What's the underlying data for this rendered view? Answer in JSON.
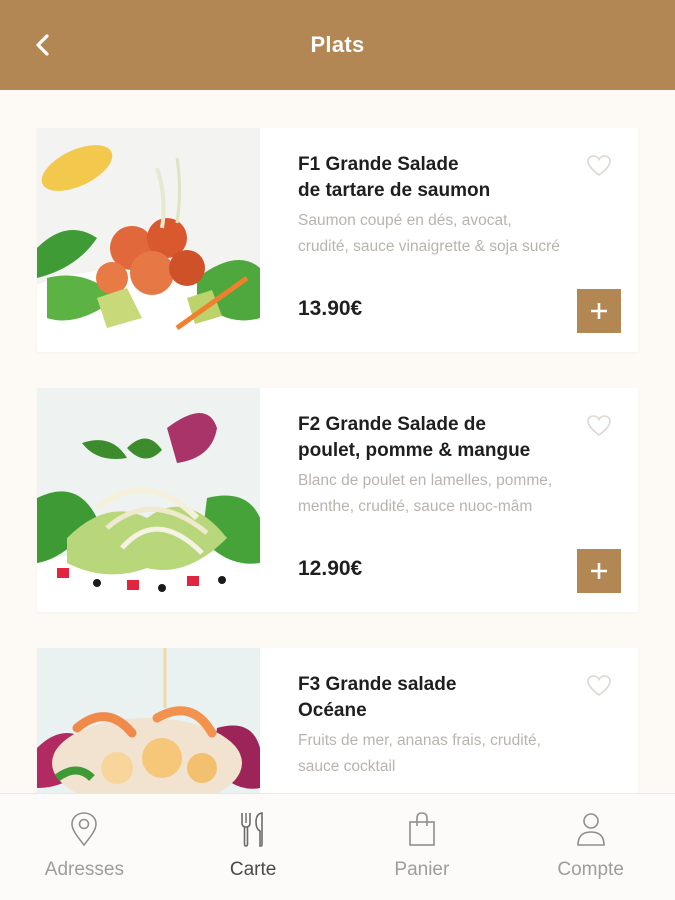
{
  "header": {
    "title": "Plats",
    "back_icon": "chevron-left-icon"
  },
  "dishes": [
    {
      "title": "F1 Grande Salade\nde tartare de saumon",
      "description": "Saumon coupé en dés, avocat,\ncrudité, sauce vinaigrette & soja sucré",
      "price": "13.90€",
      "favorite_icon": "heart-outline-icon",
      "add_icon": "plus-icon"
    },
    {
      "title": "F2 Grande Salade de\npoulet, pomme & mangue",
      "description": "Blanc de poulet en lamelles, pomme,\nmenthe, crudité, sauce nuoc-mâm",
      "price": "12.90€",
      "favorite_icon": "heart-outline-icon",
      "add_icon": "plus-icon"
    },
    {
      "title": "F3 Grande salade\nOcéane",
      "description": "Fruits de mer, ananas frais, crudité,\nsauce cocktail",
      "favorite_icon": "heart-outline-icon"
    }
  ],
  "tabbar": {
    "items": [
      {
        "label": "Adresses",
        "icon": "map-pin-icon",
        "active": false
      },
      {
        "label": "Carte",
        "icon": "fork-knife-icon",
        "active": true
      },
      {
        "label": "Panier",
        "icon": "shopping-bag-icon",
        "active": false
      },
      {
        "label": "Compte",
        "icon": "user-icon",
        "active": false
      }
    ]
  },
  "colors": {
    "accent": "#b38754",
    "background": "#fdf9f5",
    "text": "#1f1f1f",
    "muted": "#b9b3ad"
  }
}
